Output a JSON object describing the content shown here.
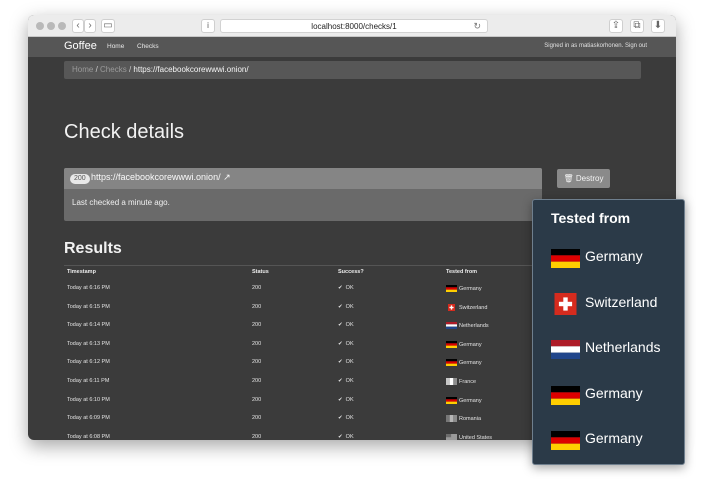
{
  "browser": {
    "url": "localhost:8000/checks/1"
  },
  "navbar": {
    "brand": "Goffee",
    "links": [
      "Home",
      "Checks"
    ],
    "user_text": "Signed in as matiaskorhonen. Sign out"
  },
  "breadcrumb": {
    "home": "Home",
    "checks": "Checks",
    "current": "https://facebookcorewwwi.onion/"
  },
  "page": {
    "title": "Check details"
  },
  "check": {
    "status_badge": "200",
    "url": "https://facebookcorewwwi.onion/",
    "last_checked": "Last checked a minute ago.",
    "destroy_label": "Destroy"
  },
  "results": {
    "title": "Results",
    "columns": [
      "Timestamp",
      "Status",
      "Success?",
      "Tested from"
    ],
    "rows": [
      {
        "time": "Today at 6:16 PM",
        "status": "200",
        "success": "OK",
        "country": "Germany"
      },
      {
        "time": "Today at 6:15 PM",
        "status": "200",
        "success": "OK",
        "country": "Switzerland"
      },
      {
        "time": "Today at 6:14 PM",
        "status": "200",
        "success": "OK",
        "country": "Netherlands"
      },
      {
        "time": "Today at 6:13 PM",
        "status": "200",
        "success": "OK",
        "country": "Germany"
      },
      {
        "time": "Today at 6:12 PM",
        "status": "200",
        "success": "OK",
        "country": "Germany"
      },
      {
        "time": "Today at 6:11 PM",
        "status": "200",
        "success": "OK",
        "country": "France"
      },
      {
        "time": "Today at 6:10 PM",
        "status": "200",
        "success": "OK",
        "country": "Germany"
      },
      {
        "time": "Today at 6:09 PM",
        "status": "200",
        "success": "OK",
        "country": "Romania"
      },
      {
        "time": "Today at 6:08 PM",
        "status": "200",
        "success": "OK",
        "country": "United States"
      }
    ]
  },
  "popup": {
    "title": "Tested from",
    "items": [
      {
        "country": "Germany",
        "flag": "de-flag-icon"
      },
      {
        "country": "Switzerland",
        "flag": "ch-flag-icon"
      },
      {
        "country": "Netherlands",
        "flag": "nl-flag-icon"
      },
      {
        "country": "Germany",
        "flag": "de-flag-icon"
      },
      {
        "country": "Germany",
        "flag": "de-flag-icon"
      }
    ]
  },
  "colors": {
    "page_bg": "#3b3b3b",
    "navbar_bg": "#565656",
    "popup_bg": "#2b3a48",
    "accent_text": "#ffffff"
  }
}
